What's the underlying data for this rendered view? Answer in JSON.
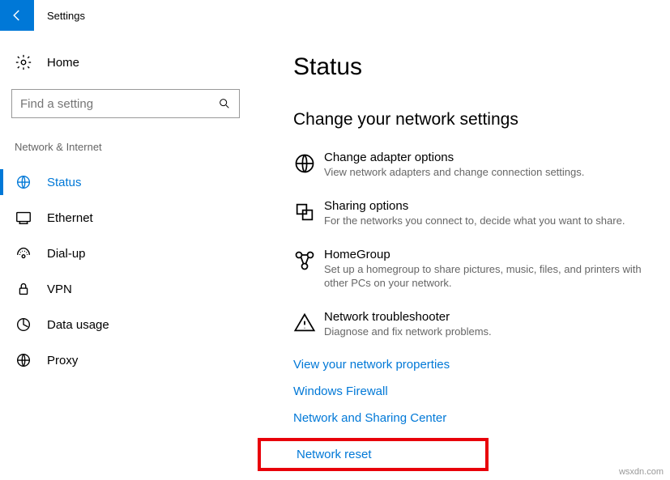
{
  "header": {
    "title": "Settings"
  },
  "sidebar": {
    "home_label": "Home",
    "search_placeholder": "Find a setting",
    "category_header": "Network & Internet",
    "items": [
      {
        "label": "Status",
        "active": true
      },
      {
        "label": "Ethernet",
        "active": false
      },
      {
        "label": "Dial-up",
        "active": false
      },
      {
        "label": "VPN",
        "active": false
      },
      {
        "label": "Data usage",
        "active": false
      },
      {
        "label": "Proxy",
        "active": false
      }
    ]
  },
  "main": {
    "title": "Status",
    "section_title": "Change your network settings",
    "items": [
      {
        "title": "Change adapter options",
        "desc": "View network adapters and change connection settings."
      },
      {
        "title": "Sharing options",
        "desc": "For the networks you connect to, decide what you want to share."
      },
      {
        "title": "HomeGroup",
        "desc": "Set up a homegroup to share pictures, music, files, and printers with other PCs on your network."
      },
      {
        "title": "Network troubleshooter",
        "desc": "Diagnose and fix network problems."
      }
    ],
    "links": [
      "View your network properties",
      "Windows Firewall",
      "Network and Sharing Center",
      "Network reset"
    ]
  },
  "watermark": "wsxdn.com"
}
